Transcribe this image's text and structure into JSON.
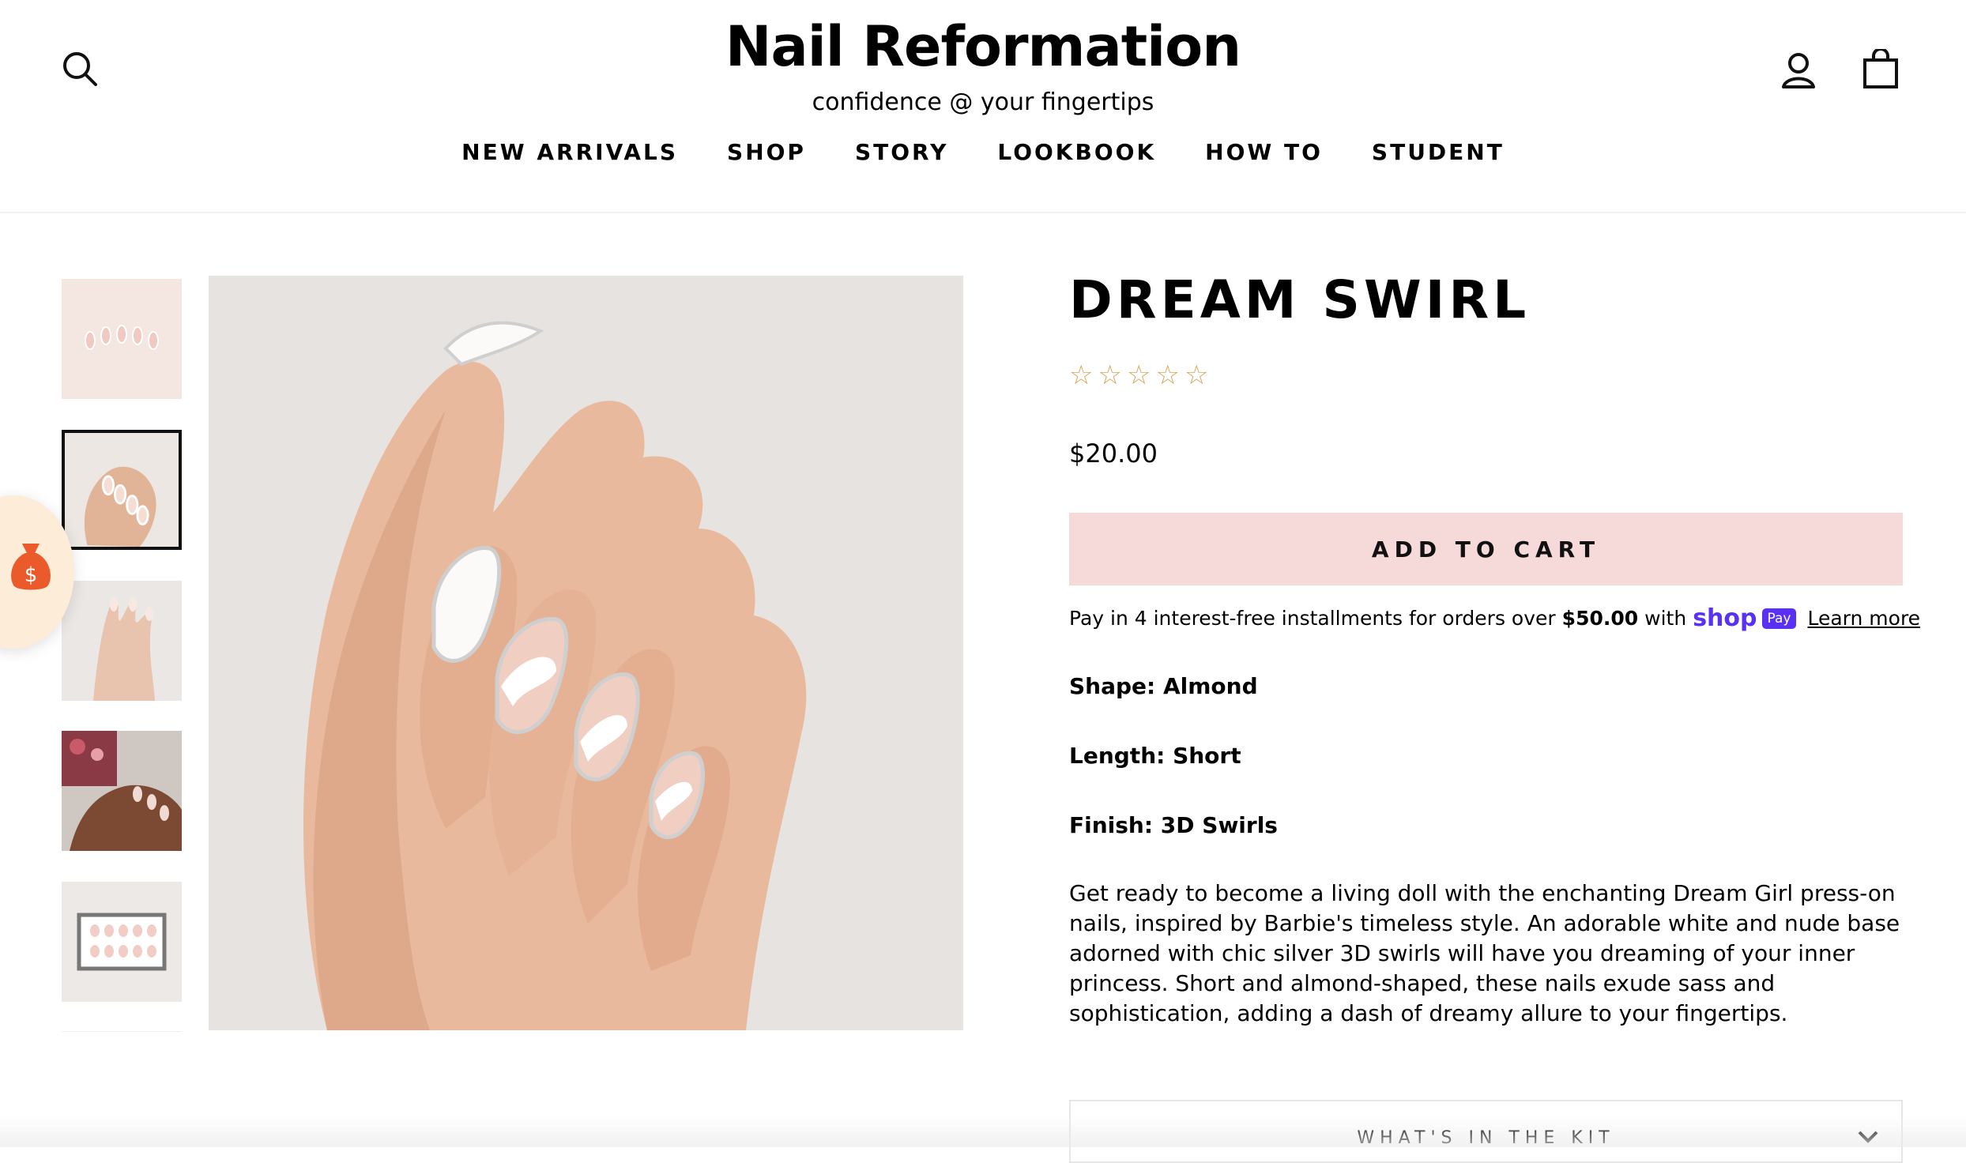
{
  "header": {
    "brand_title": "Nail Reformation",
    "brand_tagline": "confidence @ your fingertips",
    "search_icon": "search-icon",
    "account_icon": "user-icon",
    "cart_icon": "shopping-bag-icon"
  },
  "nav": {
    "items": [
      {
        "label": "NEW ARRIVALS"
      },
      {
        "label": "SHOP"
      },
      {
        "label": "STORY"
      },
      {
        "label": "LOOKBOOK"
      },
      {
        "label": "HOW TO"
      },
      {
        "label": "STUDENT"
      }
    ]
  },
  "gallery": {
    "thumbnail_count_visible": 5,
    "active_index": 1
  },
  "rewards": {
    "icon": "money-bag-icon",
    "glyph": "$"
  },
  "product": {
    "title": "DREAM SWIRL",
    "rating_stars": [
      "☆",
      "☆",
      "☆",
      "☆",
      "☆"
    ],
    "rating_value": 0,
    "price": "$20.00",
    "add_to_cart": "ADD TO CART",
    "installments": {
      "prefix": "Pay in 4 interest-free installments for orders over",
      "amount": "$50.00",
      "suffix": "with",
      "shop_word": "shop",
      "pay_word": "Pay",
      "learn_more": "Learn more"
    },
    "shape": "Shape: Almond",
    "length": "Length: Short",
    "finish": "Finish: 3D Swirls",
    "description": "Get ready to become a living doll with the enchanting Dream Girl press-on nails, inspired by Barbie's timeless style. An adorable white and nude base adorned with chic silver 3D swirls will have you dreaming of your inner princess. Short and almond-shaped, these nails exude sass and sophistication, adding a dash of dreamy allure to your fingertips.",
    "accordion_label": "WHAT'S IN THE KIT"
  },
  "colors": {
    "add_to_cart_bg": "#f6d9d9",
    "star": "#d6a75a",
    "shop_pay": "#5a31f4",
    "rewards_bg": "#fdecd8",
    "rewards_icon": "#ea5a2a"
  }
}
